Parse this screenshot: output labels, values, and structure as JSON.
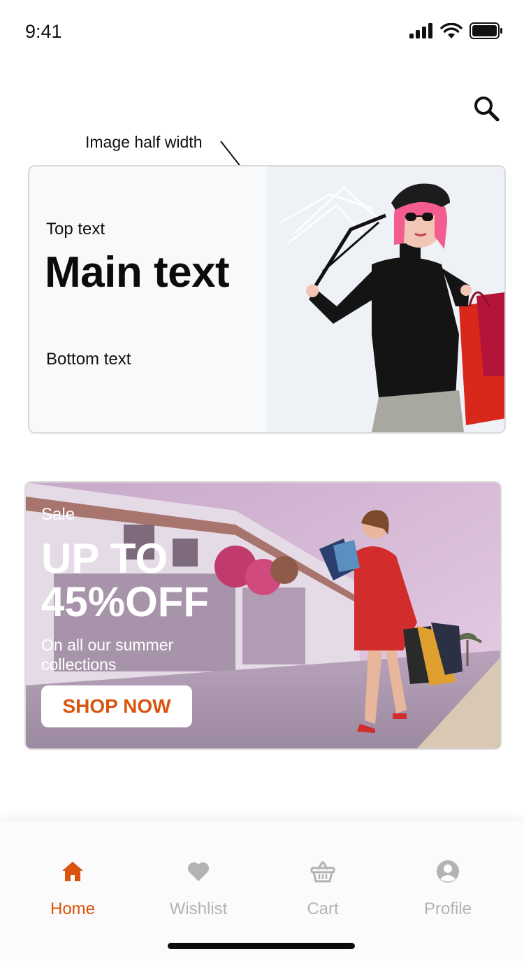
{
  "status_bar": {
    "time": "9:41",
    "icons": [
      "signal-icon",
      "wifi-icon",
      "battery-icon"
    ]
  },
  "header": {
    "search_icon": "search-icon"
  },
  "annotation": {
    "label": "Image half width"
  },
  "promo_card": {
    "top_text": "Top text",
    "main_text": "Main text",
    "bottom_text": "Bottom text"
  },
  "sale_banner": {
    "label": "Sale",
    "headline_line1": "UP TO",
    "headline_line2": "45%OFF",
    "subtitle_line1": "On all our summer",
    "subtitle_line2": "collections",
    "cta_label": "SHOP NOW"
  },
  "bottom_nav": {
    "items": [
      {
        "label": "Home",
        "icon": "home-icon",
        "active": true
      },
      {
        "label": "Wishlist",
        "icon": "heart-icon",
        "active": false
      },
      {
        "label": "Cart",
        "icon": "basket-icon",
        "active": false
      },
      {
        "label": "Profile",
        "icon": "user-circle-icon",
        "active": false
      }
    ]
  },
  "colors": {
    "accent": "#d9540f",
    "inactive": "#b3b3b3",
    "text": "#111111"
  }
}
